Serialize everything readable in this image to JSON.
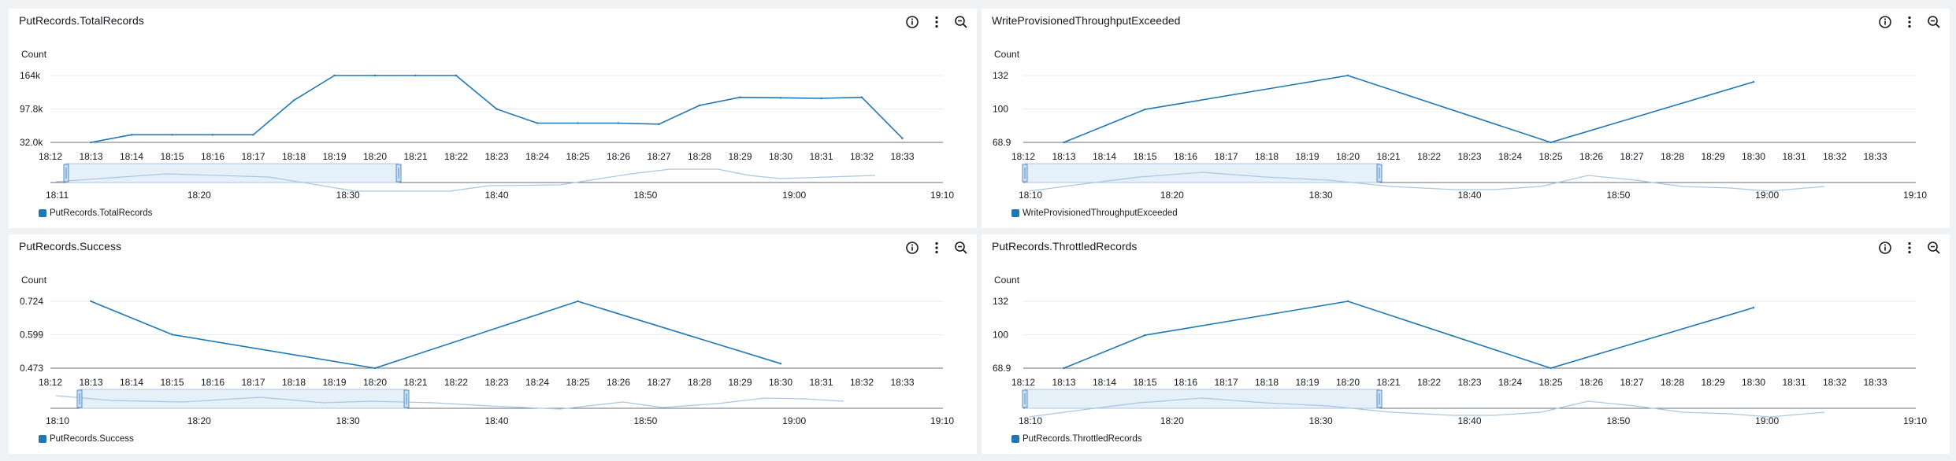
{
  "panels": [
    {
      "title": "PutRecords.TotalRecords",
      "legend": "PutRecords.TotalRecords",
      "y_axis_label": "Count"
    },
    {
      "title": "WriteProvisionedThroughputExceeded",
      "legend": "WriteProvisionedThroughputExceeded",
      "y_axis_label": "Count"
    },
    {
      "title": "PutRecords.Success",
      "legend": "PutRecords.Success",
      "y_axis_label": "Count"
    },
    {
      "title": "PutRecords.ThrottledRecords",
      "legend": "PutRecords.ThrottledRecords",
      "y_axis_label": "Count"
    }
  ],
  "chart_data": [
    {
      "type": "line",
      "title": "PutRecords.TotalRecords",
      "ylabel": "Count",
      "ylim": [
        32000,
        164000
      ],
      "y_ticks": [
        "164k",
        "97.8k",
        "32.0k"
      ],
      "x_ticks": [
        "18:12",
        "18:13",
        "18:14",
        "18:15",
        "18:16",
        "18:17",
        "18:18",
        "18:19",
        "18:20",
        "18:21",
        "18:22",
        "18:23",
        "18:24",
        "18:25",
        "18:26",
        "18:27",
        "18:28",
        "18:29",
        "18:30",
        "18:31",
        "18:32",
        "18:33"
      ],
      "x_range": [
        "18:12",
        "18:34"
      ],
      "grid": true,
      "legend_position": "bottom-left",
      "color": "#1f77b4",
      "series": [
        {
          "name": "PutRecords.TotalRecords",
          "x": [
            "18:13",
            "18:14",
            "18:15",
            "18:16",
            "18:17",
            "18:18",
            "18:19",
            "18:20",
            "18:21",
            "18:22",
            "18:23",
            "18:24",
            "18:25",
            "18:26",
            "18:27",
            "18:28",
            "18:29",
            "18:30",
            "18:31",
            "18:32",
            "18:33"
          ],
          "values": [
            32000,
            47000,
            47000,
            47000,
            47000,
            115000,
            164000,
            164000,
            164000,
            164000,
            97800,
            70000,
            70000,
            70000,
            68000,
            105000,
            121000,
            120000,
            119000,
            121000,
            40000
          ]
        }
      ],
      "navigator": {
        "ticks": [
          "18:11",
          "18:20",
          "18:30",
          "18:40",
          "18:50",
          "19:00",
          "19:10"
        ]
      }
    },
    {
      "type": "line",
      "title": "WriteProvisionedThroughputExceeded",
      "ylabel": "Count",
      "ylim": [
        68.9,
        132
      ],
      "y_ticks": [
        "132",
        "100",
        "68.9"
      ],
      "x_ticks": [
        "18:12",
        "18:13",
        "18:14",
        "18:15",
        "18:16",
        "18:17",
        "18:18",
        "18:19",
        "18:20",
        "18:21",
        "18:22",
        "18:23",
        "18:24",
        "18:25",
        "18:26",
        "18:27",
        "18:28",
        "18:29",
        "18:30",
        "18:31",
        "18:32",
        "18:33"
      ],
      "x_range": [
        "18:12",
        "18:34"
      ],
      "grid": true,
      "legend_position": "bottom-left",
      "color": "#1f77b4",
      "series": [
        {
          "name": "WriteProvisionedThroughputExceeded",
          "x": [
            "18:13",
            "18:15",
            "18:20",
            "18:25",
            "18:30"
          ],
          "values": [
            68.9,
            100,
            132,
            68.9,
            126
          ]
        }
      ],
      "navigator": {
        "ticks": [
          "18:10",
          "18:20",
          "18:30",
          "18:40",
          "18:50",
          "19:00",
          "19:10"
        ]
      }
    },
    {
      "type": "line",
      "title": "PutRecords.Success",
      "ylabel": "Count",
      "ylim": [
        0.473,
        0.724
      ],
      "y_ticks": [
        "0.724",
        "0.599",
        "0.473"
      ],
      "x_ticks": [
        "18:12",
        "18:13",
        "18:14",
        "18:15",
        "18:16",
        "18:17",
        "18:18",
        "18:19",
        "18:20",
        "18:21",
        "18:22",
        "18:23",
        "18:24",
        "18:25",
        "18:26",
        "18:27",
        "18:28",
        "18:29",
        "18:30",
        "18:31",
        "18:32",
        "18:33"
      ],
      "x_range": [
        "18:12",
        "18:34"
      ],
      "grid": true,
      "legend_position": "bottom-left",
      "color": "#1f77b4",
      "series": [
        {
          "name": "PutRecords.Success",
          "x": [
            "18:13",
            "18:15",
            "18:20",
            "18:25",
            "18:30"
          ],
          "values": [
            0.724,
            0.599,
            0.473,
            0.724,
            0.49
          ]
        }
      ],
      "navigator": {
        "ticks": [
          "18:10",
          "18:20",
          "18:30",
          "18:40",
          "18:50",
          "19:00",
          "19:10"
        ]
      }
    },
    {
      "type": "line",
      "title": "PutRecords.ThrottledRecords",
      "ylabel": "Count",
      "ylim": [
        68.9,
        132
      ],
      "y_ticks": [
        "132",
        "100",
        "68.9"
      ],
      "x_ticks": [
        "18:12",
        "18:13",
        "18:14",
        "18:15",
        "18:16",
        "18:17",
        "18:18",
        "18:19",
        "18:20",
        "18:21",
        "18:22",
        "18:23",
        "18:24",
        "18:25",
        "18:26",
        "18:27",
        "18:28",
        "18:29",
        "18:30",
        "18:31",
        "18:32",
        "18:33"
      ],
      "x_range": [
        "18:12",
        "18:34"
      ],
      "grid": true,
      "legend_position": "bottom-left",
      "color": "#1f77b4",
      "series": [
        {
          "name": "PutRecords.ThrottledRecords",
          "x": [
            "18:13",
            "18:15",
            "18:20",
            "18:25",
            "18:30"
          ],
          "values": [
            68.9,
            100,
            132,
            68.9,
            126
          ]
        }
      ],
      "navigator": {
        "ticks": [
          "18:10",
          "18:20",
          "18:30",
          "18:40",
          "18:50",
          "19:00",
          "19:10"
        ]
      }
    }
  ]
}
